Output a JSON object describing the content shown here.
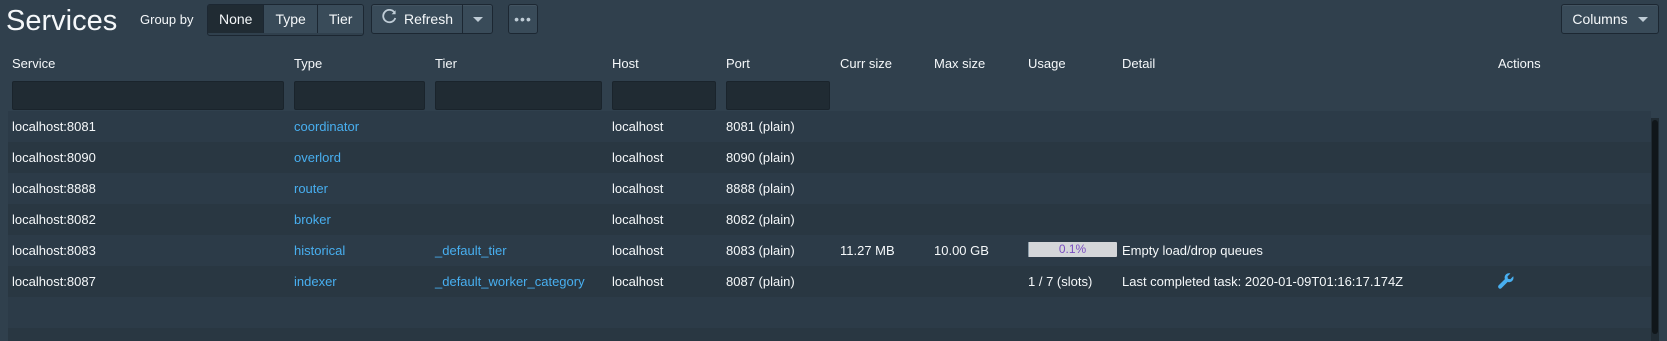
{
  "page": {
    "title": "Services",
    "group_by_label": "Group by",
    "group_options": [
      "None",
      "Type",
      "Tier"
    ],
    "selected_group": "None",
    "refresh_label": "Refresh",
    "more_label": "•••",
    "columns_label": "Columns"
  },
  "table": {
    "columns": [
      "Service",
      "Type",
      "Tier",
      "Host",
      "Port",
      "Curr size",
      "Max size",
      "Usage",
      "Detail",
      "Actions"
    ],
    "rows": [
      {
        "service": "localhost:8081",
        "type": "coordinator",
        "tier": "",
        "host": "localhost",
        "port": "8081 (plain)",
        "curr_size": "",
        "max_size": "",
        "usage": "",
        "detail": ""
      },
      {
        "service": "localhost:8090",
        "type": "overlord",
        "tier": "",
        "host": "localhost",
        "port": "8090 (plain)",
        "curr_size": "",
        "max_size": "",
        "usage": "",
        "detail": ""
      },
      {
        "service": "localhost:8888",
        "type": "router",
        "tier": "",
        "host": "localhost",
        "port": "8888 (plain)",
        "curr_size": "",
        "max_size": "",
        "usage": "",
        "detail": ""
      },
      {
        "service": "localhost:8082",
        "type": "broker",
        "tier": "",
        "host": "localhost",
        "port": "8082 (plain)",
        "curr_size": "",
        "max_size": "",
        "usage": "",
        "detail": ""
      },
      {
        "service": "localhost:8083",
        "type": "historical",
        "tier": "_default_tier",
        "host": "localhost",
        "port": "8083 (plain)",
        "curr_size": "11.27 MB",
        "max_size": "10.00 GB",
        "usage": "0.1%",
        "usage_fraction": 0.001,
        "detail": "Empty load/drop queues"
      },
      {
        "service": "localhost:8087",
        "type": "indexer",
        "tier": "_default_worker_category",
        "host": "localhost",
        "port": "8087 (plain)",
        "curr_size": "",
        "max_size": "",
        "usage": "1 / 7 (slots)",
        "detail": "Last completed task: 2020-01-09T01:16:17.174Z",
        "action_icon": "wrench-icon"
      }
    ]
  },
  "colors": {
    "background": "#30404d",
    "link": "#48aff0",
    "usage_text": "#7a4fc2"
  }
}
